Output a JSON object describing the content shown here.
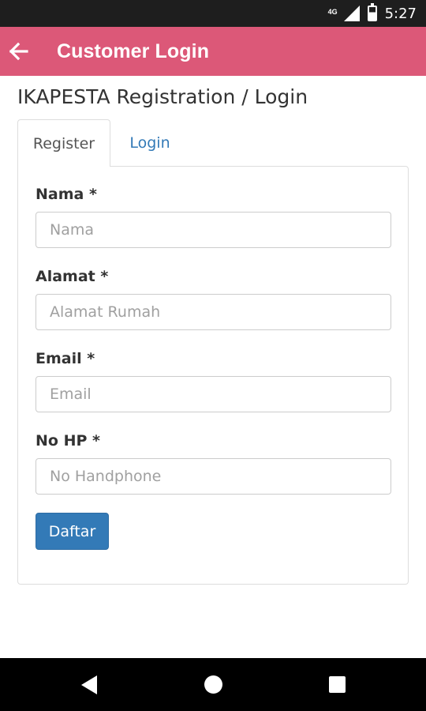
{
  "status_bar": {
    "network": "4G",
    "time": "5:27"
  },
  "app_bar": {
    "title": "Customer Login",
    "back_icon": "arrow-left-icon"
  },
  "page": {
    "heading": "IKAPESTA Registration / Login"
  },
  "tabs": [
    {
      "label": "Register",
      "active": true
    },
    {
      "label": "Login",
      "active": false
    }
  ],
  "form": {
    "fields": [
      {
        "label": "Nama *",
        "placeholder": "Nama",
        "value": ""
      },
      {
        "label": "Alamat *",
        "placeholder": "Alamat Rumah",
        "value": ""
      },
      {
        "label": "Email *",
        "placeholder": "Email",
        "value": ""
      },
      {
        "label": "No HP *",
        "placeholder": "No Handphone",
        "value": ""
      }
    ],
    "submit_label": "Daftar"
  },
  "colors": {
    "app_bar": "#dc5878",
    "primary_button": "#337ab7",
    "tab_link": "#337ab7"
  }
}
